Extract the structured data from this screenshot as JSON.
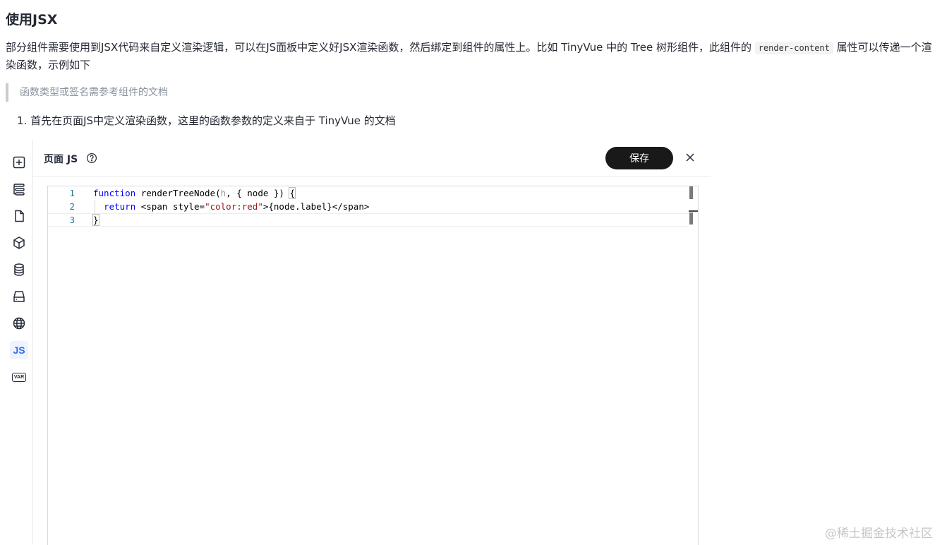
{
  "article": {
    "heading": "使用JSX",
    "paragraph": {
      "part1": "部分组件需要使用到JSX代码来自定义渲染逻辑，可以在JS面板中定义好JSX渲染函数，然后绑定到组件的属性上。比如 TinyVue 中的 Tree 树形组件，此组件的 ",
      "code": "render-content",
      "part2": " 属性可以传递一个渲染函数，示例如下"
    },
    "blockquote": "函数类型或签名需参考组件的文档",
    "list_item": "1. 首先在页面JS中定义渲染函数，这里的函数参数的定义来自于 TinyVue 的文档"
  },
  "sidebar": {
    "items": [
      {
        "icon": "add-square-icon"
      },
      {
        "icon": "outline-tree-icon"
      },
      {
        "icon": "page-icon"
      },
      {
        "icon": "cube-icon"
      },
      {
        "icon": "database-icon"
      },
      {
        "icon": "drawer-icon"
      },
      {
        "icon": "globe-icon"
      },
      {
        "icon": "js-icon",
        "label": "JS",
        "active": true
      },
      {
        "icon": "var-icon",
        "label": "VAR"
      }
    ]
  },
  "panel": {
    "title": "页面 JS",
    "save_label": "保存"
  },
  "editor": {
    "lines": [
      {
        "n": "1",
        "tokens": [
          {
            "t": "function",
            "c": "kw"
          },
          {
            "t": " renderTreeNode(",
            "c": ""
          },
          {
            "t": "h",
            "c": "param"
          },
          {
            "t": ", { node }) ",
            "c": ""
          },
          {
            "t": "{",
            "c": "bracket-hl"
          }
        ]
      },
      {
        "n": "2",
        "tokens": [
          {
            "t": "  ",
            "c": ""
          },
          {
            "t": "return",
            "c": "kw"
          },
          {
            "t": " <span style=",
            "c": ""
          },
          {
            "t": "\"color:red\"",
            "c": "str"
          },
          {
            "t": ">{node.label}</span>",
            "c": ""
          }
        ]
      },
      {
        "n": "3",
        "tokens": [
          {
            "t": "}",
            "c": "bracket-hl"
          }
        ]
      }
    ]
  },
  "watermark": "@稀土掘金技术社区"
}
